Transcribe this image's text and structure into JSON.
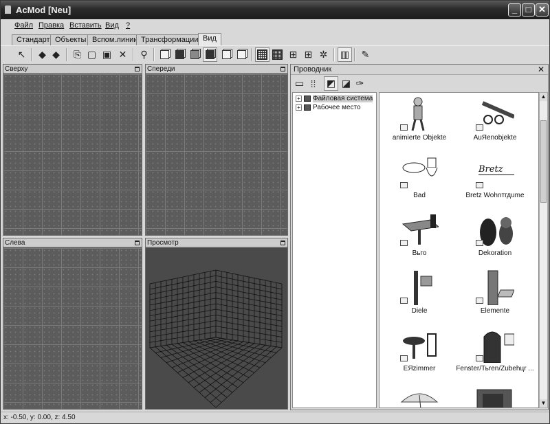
{
  "window": {
    "title": "AcMod [Neu]"
  },
  "menu": [
    "Файл",
    "Правка",
    "Вставить",
    "Вид",
    "?"
  ],
  "tabs": [
    "Стандарт",
    "Объекты",
    "Вспом.линии",
    "Трансформации",
    "Вид"
  ],
  "active_tab": "Вид",
  "viewports": {
    "top": "Сверху",
    "front": "Спереди",
    "left": "Слева",
    "preview": "Просмотр"
  },
  "explorer": {
    "title": "Проводник",
    "tree": [
      "Файловая система",
      "Рабочее место"
    ],
    "items": [
      "animierte Objekte",
      "AuЯenobjekte",
      "Bad",
      "Bretz Wohnтгдume",
      "Вьго",
      "Dekoration",
      "Diele",
      "Elemente",
      "EЯzimmer",
      "Fenster/Тьren/Zubehцr ..."
    ]
  },
  "status": "x: -0.50, y: 0.00, z: 4.50",
  "icons": [
    "pointer-icon",
    "rotate-left-icon",
    "rotate-right-icon",
    "copy-icon",
    "paste-icon",
    "clipboard-icon",
    "delete-icon",
    "magnifier-icon",
    "cube-wire-icon",
    "cube-solid-icon",
    "cube-shaded-icon",
    "cube-dark-icon",
    "cube-light-icon",
    "cube-outline-icon",
    "grid-icon",
    "grid-fine-icon",
    "grid-snap-icon",
    "grid-cross-icon",
    "grid-star-icon",
    "book-icon",
    "measure-icon"
  ]
}
